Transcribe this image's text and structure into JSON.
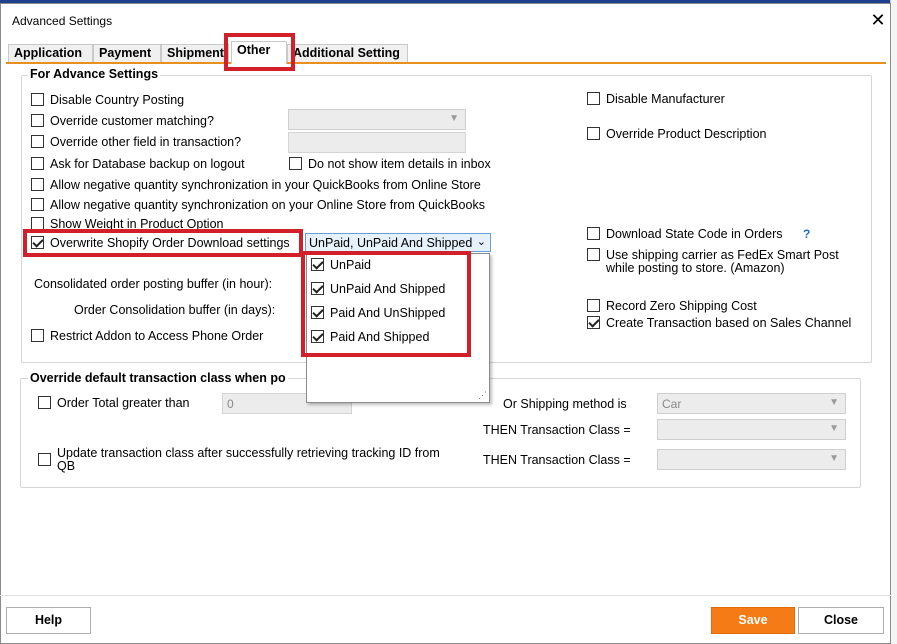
{
  "window": {
    "title": "Advanced Settings",
    "close_glyph": "✕"
  },
  "tabs": [
    "Application",
    "Payment",
    "Shipment",
    "Other",
    "Additional Setting"
  ],
  "active_tab": "Other",
  "advance_settings": {
    "legend": "For Advance Settings",
    "disable_country_posting": "Disable Country Posting",
    "override_customer_matching": "Override customer matching?",
    "override_other_field": "Override other field in transaction?",
    "ask_db_backup": "Ask for Database backup on logout",
    "do_not_show_item_details": "Do not show item details in inbox",
    "allow_negative_qb": "Allow negative quantity synchronization in your QuickBooks from  Online Store",
    "allow_negative_store": "Allow negative quantity synchronization on your Online Store from QuickBooks",
    "show_weight": "Show Weight in Product Option",
    "overwrite_shopify": "Overwrite Shopify Order Download settings",
    "consolidated_buffer": "Consolidated order posting buffer (in hour):",
    "order_consolidation_buffer": "Order Consolidation buffer (in days):",
    "restrict_addon": "Restrict Addon to Access Phone Order",
    "disable_manufacturer": "Disable Manufacturer",
    "override_product_description": "Override Product Description",
    "download_state_code": "Download State Code in Orders",
    "help_mark": "?",
    "use_shipping_carrier_line1": "Use shipping carrier as FedEx Smart Post",
    "use_shipping_carrier_line2": "while posting to store. (Amazon)",
    "record_zero_shipping": "Record Zero Shipping Cost",
    "create_transaction_channel": "Create Transaction based on Sales Channel"
  },
  "shopify_dropdown": {
    "selected_text": "UnPaid, UnPaid And Shipped",
    "options": [
      {
        "label": "UnPaid",
        "checked": true
      },
      {
        "label": "UnPaid And Shipped",
        "checked": true
      },
      {
        "label": "Paid And UnShipped",
        "checked": true
      },
      {
        "label": "Paid And Shipped",
        "checked": true
      }
    ]
  },
  "override_class": {
    "legend": "Override default transaction class when po",
    "order_total_label": "Order Total greater than",
    "order_total_value": "0",
    "or_shipping_method": "Or Shipping method is",
    "shipping_method_value": "Car",
    "then_class_1": "THEN Transaction Class =",
    "update_class_line1": "Update transaction class after successfully retrieving tracking ID from",
    "update_class_line2": "QB",
    "then_class_2": "THEN Transaction Class ="
  },
  "footer": {
    "help": "Help",
    "save": "Save",
    "close": "Close"
  },
  "colors": {
    "accent_orange": "#f47b16",
    "highlight_red": "#d2202a",
    "dropdown_blue": "#e5f1fb"
  }
}
